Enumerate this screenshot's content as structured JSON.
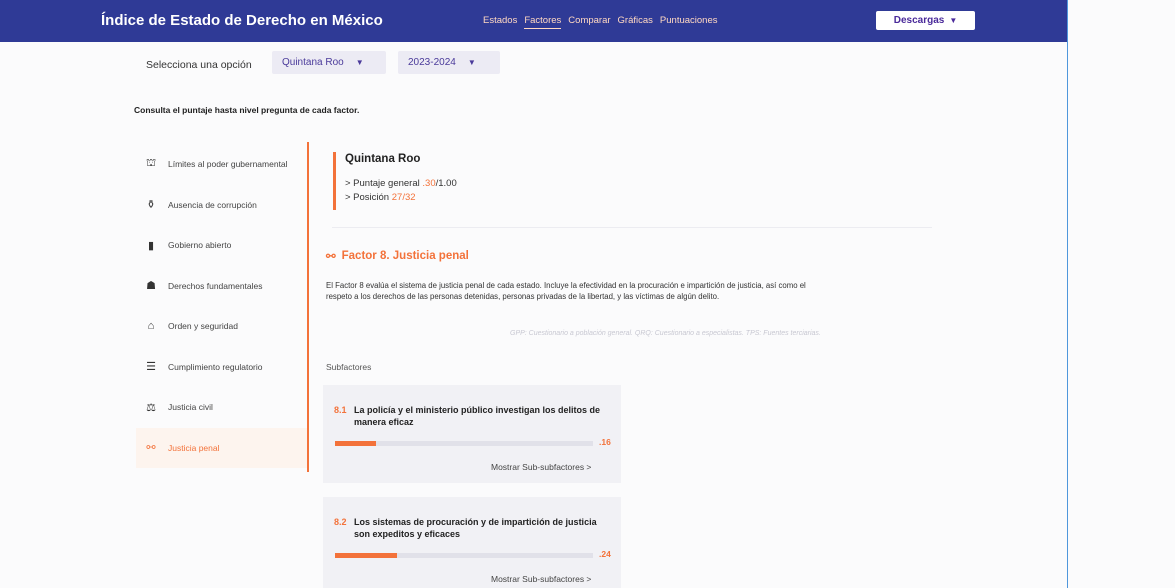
{
  "header": {
    "title": "Índice de Estado de Derecho en México",
    "nav": [
      {
        "label": "Estados",
        "active": false
      },
      {
        "label": "Factores",
        "active": true
      },
      {
        "label": "Comparar",
        "active": false
      },
      {
        "label": "Gráficas",
        "active": false
      },
      {
        "label": "Puntuaciones",
        "active": false
      }
    ],
    "downloads_label": "Descargas",
    "downloads_icon": "chevron-down-icon"
  },
  "selector": {
    "label": "Selecciona una opción",
    "state": "Quintana Roo",
    "year": "2023-2024",
    "chevron": "⌄"
  },
  "instruction": "Consulta el puntaje hasta nivel pregunta de cada factor.",
  "sidebar": {
    "items": [
      {
        "label": "Límites al poder gubernamental",
        "icon": "⛫",
        "icon_name": "government-building-icon",
        "active": false
      },
      {
        "label": "Ausencia de corrupción",
        "icon": "⚱",
        "icon_name": "money-bag-icon",
        "active": false
      },
      {
        "label": "Gobierno abierto",
        "icon": "▮",
        "icon_name": "open-door-icon",
        "active": false
      },
      {
        "label": "Derechos fundamentales",
        "icon": "☗",
        "icon_name": "people-icon",
        "active": false
      },
      {
        "label": "Orden y seguridad",
        "icon": "⌂",
        "icon_name": "lock-house-icon",
        "active": false
      },
      {
        "label": "Cumplimiento regulatorio",
        "icon": "☰",
        "icon_name": "document-icon",
        "active": false
      },
      {
        "label": "Justicia civil",
        "icon": "⚖",
        "icon_name": "scales-icon",
        "active": false
      },
      {
        "label": "Justicia penal",
        "icon": "⚯",
        "icon_name": "handcuffs-icon",
        "active": true
      }
    ]
  },
  "summary": {
    "state": "Quintana Roo",
    "score_label": "> Puntaje general",
    "score_value": ".30",
    "score_max": "/1.00",
    "rank_label": "> Posición",
    "rank_value": "27/32"
  },
  "factor": {
    "icon": "⚯",
    "title": "Factor 8. Justicia penal",
    "description": "El Factor 8 evalúa el sistema de justicia penal de cada estado. Incluye la efectividad en la procuración e impartición de justicia, así como el respeto a los derechos de las personas detenidas, personas privadas de la libertad, y las víctimas de algún delito.",
    "legend": "GPP: Cuestionario a población general. QRQ: Cuestionario a especialistas. TPS: Fuentes terciarias."
  },
  "subfactors": {
    "heading": "Subfactores",
    "link_label": "Mostrar Sub-subfactores >",
    "accent": "#f3723a",
    "items": [
      {
        "number": "8.1",
        "title": "La policía y el ministerio público investigan los delitos de manera eficaz",
        "score": ".16",
        "value": 0.16
      },
      {
        "number": "8.2",
        "title": "Los sistemas de procuración y de impartición de justicia son expeditos y eficaces",
        "score": ".24",
        "value": 0.24
      }
    ]
  }
}
